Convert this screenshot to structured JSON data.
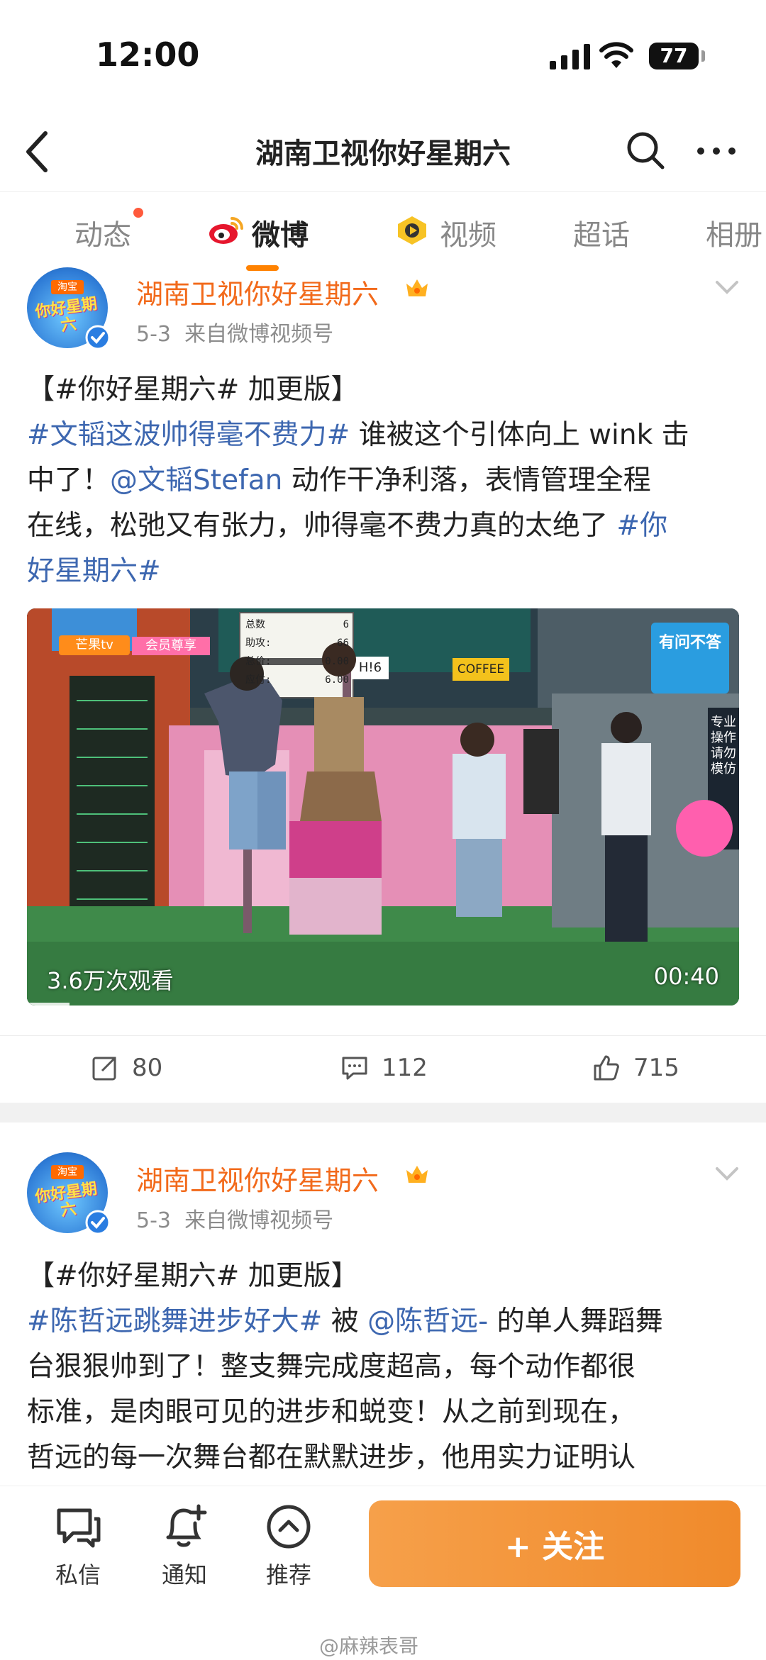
{
  "status_bar": {
    "time": "12:00",
    "battery": "77"
  },
  "nav": {
    "title": "湖南卫视你好星期六"
  },
  "tabs": [
    {
      "label": "动态"
    },
    {
      "label": "微博"
    },
    {
      "label": "视频"
    },
    {
      "label": "超话"
    },
    {
      "label": "相册"
    }
  ],
  "posts": [
    {
      "author": "湖南卫视你好星期六",
      "date": "5-3",
      "source": "来自微博视频号",
      "avatar_badge": "淘宝",
      "avatar_text": "你好星期六",
      "lines": [
        {
          "tag": "【#你好星期六# ",
          "text": "加更版】",
          "tag2": "",
          "text2": "",
          "tag3": "",
          "text3": ""
        },
        {
          "tag": "#文韬这波帅得毫不费力# ",
          "text": "谁被这个引体向上 wink 击",
          "tag2": "",
          "text2": "",
          "tag3": "",
          "text3": ""
        },
        {
          "tag": "",
          "text": "中了！",
          "tag2": "@文韬Stefan",
          "text2": " 动作干净利落，表情管理全程",
          "tag3": "",
          "text3": ""
        },
        {
          "tag": "",
          "text": "在线，松弛又有张力，帅得毫不费力真的太绝了 ",
          "tag2": "#你",
          "text2": "",
          "tag3": "",
          "text3": ""
        },
        {
          "tag": "好星期六#",
          "text": "",
          "tag2": "",
          "text2": "",
          "tag3": "",
          "text3": ""
        }
      ],
      "video": {
        "views": "3.6万次观看",
        "duration": "00:40",
        "progress": 0.06,
        "channel_logo": "芒果tv",
        "vip_label": "会员尊享",
        "sign_h6": "H!6",
        "sign_coffee": "COFFEE",
        "corner_text": "有问不答",
        "side_text": "专业操作 请勿模仿",
        "scoreboard": [
          "总数",
          "6",
          "助攻:",
          "66",
          "总价:",
          "0.00",
          "应付:",
          "6.00"
        ]
      },
      "actions": {
        "repost": "80",
        "comment": "112",
        "like": "715"
      }
    },
    {
      "author": "湖南卫视你好星期六",
      "date": "5-3",
      "source": "来自微博视频号",
      "avatar_badge": "淘宝",
      "avatar_text": "你好星期六",
      "lines": [
        {
          "tag": "【#你好星期六# ",
          "text": "加更版】",
          "tag2": "",
          "text2": "",
          "tag3": "",
          "text3": ""
        },
        {
          "tag": "#陈哲远跳舞进步好大# ",
          "text": "被 ",
          "tag2": "@陈哲远-",
          "text2": " 的单人舞蹈舞",
          "tag3": "",
          "text3": ""
        },
        {
          "tag": "",
          "text": "台狠狠帅到了！整支舞完成度超高，每个动作都很",
          "tag2": "",
          "text2": "",
          "tag3": "",
          "text3": ""
        },
        {
          "tag": "",
          "text": "标准，是肉眼可见的进步和蜕变！从之前到现在，",
          "tag2": "",
          "text2": "",
          "tag3": "",
          "text3": ""
        },
        {
          "tag": "",
          "text": "哲远的每一次舞台都在默默进步，他用实力证明认",
          "tag2": "",
          "text2": "",
          "tag3": "",
          "text3": ""
        }
      ]
    }
  ],
  "bottom_bar": {
    "message": "私信",
    "notify": "通知",
    "recommend": "推荐",
    "follow": "+ 关注"
  },
  "watermark": "@麻辣表哥",
  "colors": {
    "brand_orange": "#f26a1b",
    "tag_blue": "#3d67b0",
    "follow_button": "#f08a2b"
  }
}
